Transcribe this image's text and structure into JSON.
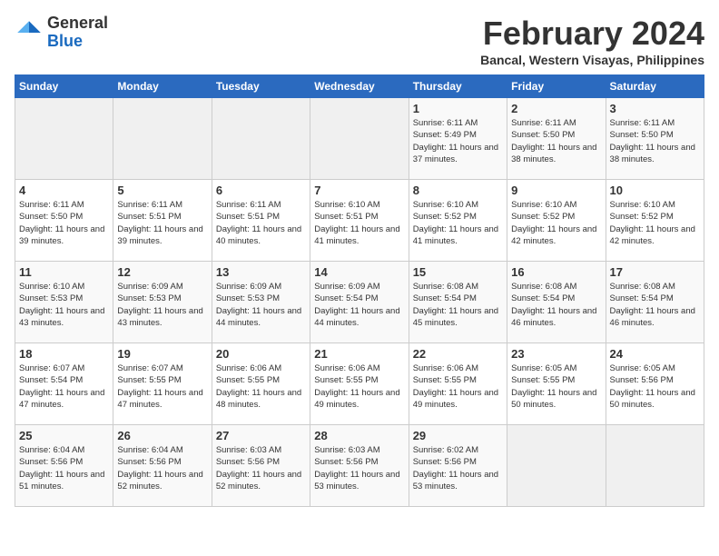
{
  "header": {
    "logo_general": "General",
    "logo_blue": "Blue",
    "title": "February 2024",
    "subtitle": "Bancal, Western Visayas, Philippines"
  },
  "days_of_week": [
    "Sunday",
    "Monday",
    "Tuesday",
    "Wednesday",
    "Thursday",
    "Friday",
    "Saturday"
  ],
  "weeks": [
    [
      {
        "day": "",
        "sunrise": "",
        "sunset": "",
        "daylight": ""
      },
      {
        "day": "",
        "sunrise": "",
        "sunset": "",
        "daylight": ""
      },
      {
        "day": "",
        "sunrise": "",
        "sunset": "",
        "daylight": ""
      },
      {
        "day": "",
        "sunrise": "",
        "sunset": "",
        "daylight": ""
      },
      {
        "day": "1",
        "sunrise": "Sunrise: 6:11 AM",
        "sunset": "Sunset: 5:49 PM",
        "daylight": "Daylight: 11 hours and 37 minutes."
      },
      {
        "day": "2",
        "sunrise": "Sunrise: 6:11 AM",
        "sunset": "Sunset: 5:50 PM",
        "daylight": "Daylight: 11 hours and 38 minutes."
      },
      {
        "day": "3",
        "sunrise": "Sunrise: 6:11 AM",
        "sunset": "Sunset: 5:50 PM",
        "daylight": "Daylight: 11 hours and 38 minutes."
      }
    ],
    [
      {
        "day": "4",
        "sunrise": "Sunrise: 6:11 AM",
        "sunset": "Sunset: 5:50 PM",
        "daylight": "Daylight: 11 hours and 39 minutes."
      },
      {
        "day": "5",
        "sunrise": "Sunrise: 6:11 AM",
        "sunset": "Sunset: 5:51 PM",
        "daylight": "Daylight: 11 hours and 39 minutes."
      },
      {
        "day": "6",
        "sunrise": "Sunrise: 6:11 AM",
        "sunset": "Sunset: 5:51 PM",
        "daylight": "Daylight: 11 hours and 40 minutes."
      },
      {
        "day": "7",
        "sunrise": "Sunrise: 6:10 AM",
        "sunset": "Sunset: 5:51 PM",
        "daylight": "Daylight: 11 hours and 41 minutes."
      },
      {
        "day": "8",
        "sunrise": "Sunrise: 6:10 AM",
        "sunset": "Sunset: 5:52 PM",
        "daylight": "Daylight: 11 hours and 41 minutes."
      },
      {
        "day": "9",
        "sunrise": "Sunrise: 6:10 AM",
        "sunset": "Sunset: 5:52 PM",
        "daylight": "Daylight: 11 hours and 42 minutes."
      },
      {
        "day": "10",
        "sunrise": "Sunrise: 6:10 AM",
        "sunset": "Sunset: 5:52 PM",
        "daylight": "Daylight: 11 hours and 42 minutes."
      }
    ],
    [
      {
        "day": "11",
        "sunrise": "Sunrise: 6:10 AM",
        "sunset": "Sunset: 5:53 PM",
        "daylight": "Daylight: 11 hours and 43 minutes."
      },
      {
        "day": "12",
        "sunrise": "Sunrise: 6:09 AM",
        "sunset": "Sunset: 5:53 PM",
        "daylight": "Daylight: 11 hours and 43 minutes."
      },
      {
        "day": "13",
        "sunrise": "Sunrise: 6:09 AM",
        "sunset": "Sunset: 5:53 PM",
        "daylight": "Daylight: 11 hours and 44 minutes."
      },
      {
        "day": "14",
        "sunrise": "Sunrise: 6:09 AM",
        "sunset": "Sunset: 5:54 PM",
        "daylight": "Daylight: 11 hours and 44 minutes."
      },
      {
        "day": "15",
        "sunrise": "Sunrise: 6:08 AM",
        "sunset": "Sunset: 5:54 PM",
        "daylight": "Daylight: 11 hours and 45 minutes."
      },
      {
        "day": "16",
        "sunrise": "Sunrise: 6:08 AM",
        "sunset": "Sunset: 5:54 PM",
        "daylight": "Daylight: 11 hours and 46 minutes."
      },
      {
        "day": "17",
        "sunrise": "Sunrise: 6:08 AM",
        "sunset": "Sunset: 5:54 PM",
        "daylight": "Daylight: 11 hours and 46 minutes."
      }
    ],
    [
      {
        "day": "18",
        "sunrise": "Sunrise: 6:07 AM",
        "sunset": "Sunset: 5:54 PM",
        "daylight": "Daylight: 11 hours and 47 minutes."
      },
      {
        "day": "19",
        "sunrise": "Sunrise: 6:07 AM",
        "sunset": "Sunset: 5:55 PM",
        "daylight": "Daylight: 11 hours and 47 minutes."
      },
      {
        "day": "20",
        "sunrise": "Sunrise: 6:06 AM",
        "sunset": "Sunset: 5:55 PM",
        "daylight": "Daylight: 11 hours and 48 minutes."
      },
      {
        "day": "21",
        "sunrise": "Sunrise: 6:06 AM",
        "sunset": "Sunset: 5:55 PM",
        "daylight": "Daylight: 11 hours and 49 minutes."
      },
      {
        "day": "22",
        "sunrise": "Sunrise: 6:06 AM",
        "sunset": "Sunset: 5:55 PM",
        "daylight": "Daylight: 11 hours and 49 minutes."
      },
      {
        "day": "23",
        "sunrise": "Sunrise: 6:05 AM",
        "sunset": "Sunset: 5:55 PM",
        "daylight": "Daylight: 11 hours and 50 minutes."
      },
      {
        "day": "24",
        "sunrise": "Sunrise: 6:05 AM",
        "sunset": "Sunset: 5:56 PM",
        "daylight": "Daylight: 11 hours and 50 minutes."
      }
    ],
    [
      {
        "day": "25",
        "sunrise": "Sunrise: 6:04 AM",
        "sunset": "Sunset: 5:56 PM",
        "daylight": "Daylight: 11 hours and 51 minutes."
      },
      {
        "day": "26",
        "sunrise": "Sunrise: 6:04 AM",
        "sunset": "Sunset: 5:56 PM",
        "daylight": "Daylight: 11 hours and 52 minutes."
      },
      {
        "day": "27",
        "sunrise": "Sunrise: 6:03 AM",
        "sunset": "Sunset: 5:56 PM",
        "daylight": "Daylight: 11 hours and 52 minutes."
      },
      {
        "day": "28",
        "sunrise": "Sunrise: 6:03 AM",
        "sunset": "Sunset: 5:56 PM",
        "daylight": "Daylight: 11 hours and 53 minutes."
      },
      {
        "day": "29",
        "sunrise": "Sunrise: 6:02 AM",
        "sunset": "Sunset: 5:56 PM",
        "daylight": "Daylight: 11 hours and 53 minutes."
      },
      {
        "day": "",
        "sunrise": "",
        "sunset": "",
        "daylight": ""
      },
      {
        "day": "",
        "sunrise": "",
        "sunset": "",
        "daylight": ""
      }
    ]
  ]
}
